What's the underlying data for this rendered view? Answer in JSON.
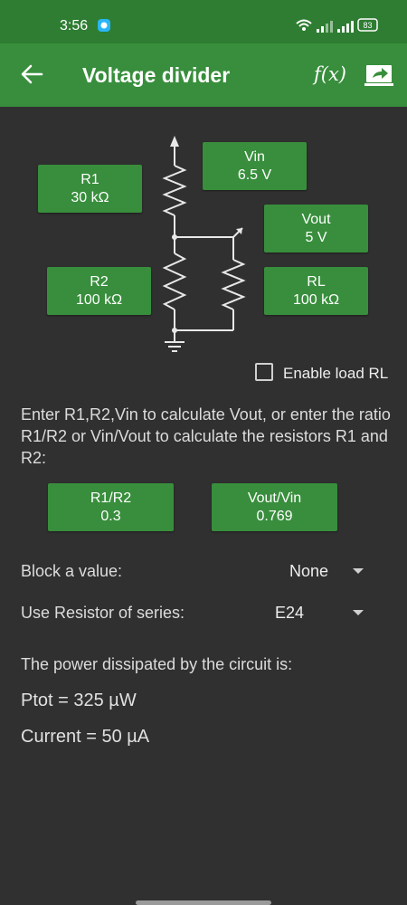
{
  "status": {
    "time": "3:56",
    "battery": "83"
  },
  "appbar": {
    "title": "Voltage divider",
    "fx_label": "f(x)"
  },
  "circuit": {
    "r1": {
      "label": "R1",
      "value": "30 kΩ"
    },
    "r2": {
      "label": "R2",
      "value": "100 kΩ"
    },
    "vin": {
      "label": "Vin",
      "value": "6.5 V"
    },
    "vout": {
      "label": "Vout",
      "value": "5 V"
    },
    "rl": {
      "label": "RL",
      "value": "100 kΩ"
    }
  },
  "load": {
    "checkbox_label": "Enable load RL",
    "checked": false
  },
  "instructions": "Enter R1,R2,Vin to calculate Vout, or enter the ratio R1/R2 or Vin/Vout to calculate the resistors R1 and R2:",
  "ratios": {
    "r1r2": {
      "label": "R1/R2",
      "value": "0.3"
    },
    "voutvin": {
      "label": "Vout/Vin",
      "value": "0.769"
    }
  },
  "settings": {
    "block_label": "Block a value:",
    "block_value": "None",
    "series_label": "Use Resistor of series:",
    "series_value": "E24"
  },
  "power": {
    "title": "The power dissipated by the circuit is:",
    "ptot": "Ptot = 325 µW",
    "current": "Current = 50 µA"
  },
  "colors": {
    "accent": "#388e3c",
    "status_bar": "#2e7d32",
    "background": "#303030"
  }
}
